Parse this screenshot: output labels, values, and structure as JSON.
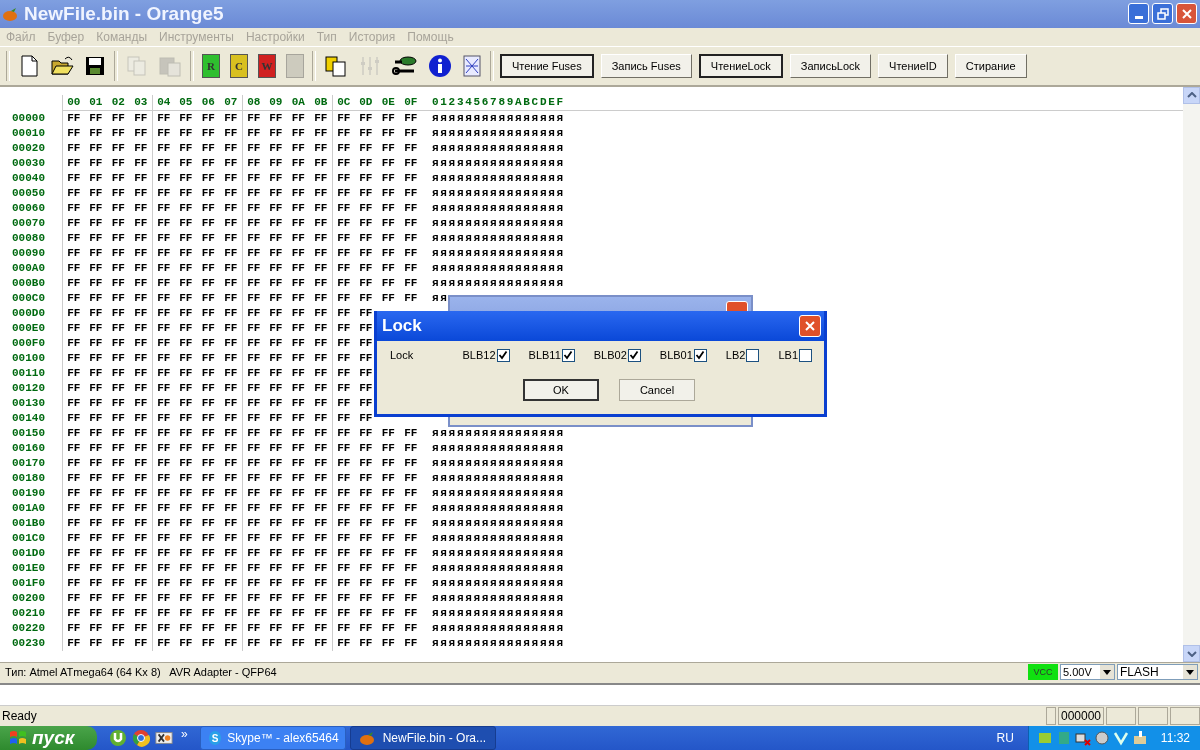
{
  "window": {
    "title": "NewFile.bin - Orange5"
  },
  "menu": [
    {
      "label": "Файл",
      "disabled": true
    },
    {
      "label": "Буфер",
      "disabled": true
    },
    {
      "label": "Команды",
      "disabled": true
    },
    {
      "label": "Инструменты",
      "disabled": true
    },
    {
      "label": "Настройки",
      "disabled": true
    },
    {
      "label": "Тип",
      "disabled": true
    },
    {
      "label": "История",
      "disabled": true
    },
    {
      "label": "Помощь",
      "disabled": true
    }
  ],
  "toolbar": {
    "groups": [
      [
        {
          "kind": "new",
          "disabled": false
        },
        {
          "kind": "open",
          "disabled": false
        },
        {
          "kind": "save",
          "disabled": false
        }
      ],
      [
        {
          "kind": "copy",
          "disabled": true
        },
        {
          "kind": "paste",
          "disabled": true
        }
      ],
      [
        {
          "kind": "chip",
          "label": "R",
          "color": "#2fbf2f",
          "disabled": false
        },
        {
          "kind": "chip",
          "label": "C",
          "color": "#d8c020",
          "disabled": false
        },
        {
          "kind": "chip",
          "label": "W",
          "color": "#d02020",
          "disabled": false
        },
        {
          "kind": "chip",
          "color": "#a8a8a0",
          "disabled": true
        }
      ],
      [
        {
          "kind": "clipboard",
          "disabled": false
        },
        {
          "kind": "sliders",
          "disabled": true
        },
        {
          "kind": "tools",
          "disabled": false
        },
        {
          "kind": "info",
          "disabled": false
        },
        {
          "kind": "pattern",
          "disabled": false
        }
      ]
    ],
    "buttons": [
      {
        "label": "Чтение Fuses",
        "selected": true
      },
      {
        "label": "Запись Fuses",
        "selected": false
      },
      {
        "label": "ЧтениеLock",
        "selected": true
      },
      {
        "label": "ЗаписьLock",
        "selected": false
      },
      {
        "label": "ЧтениеID",
        "selected": false
      },
      {
        "label": "Стирание",
        "selected": false
      }
    ]
  },
  "hex_view": {
    "columns": [
      "00",
      "01",
      "02",
      "03",
      "04",
      "05",
      "06",
      "07",
      "08",
      "09",
      "0A",
      "0B",
      "0C",
      "0D",
      "0E",
      "0F"
    ],
    "ascii_header": "0123456789ABCDEF",
    "rows": [
      {
        "address": "00000",
        "bytes": [
          "FF",
          "FF",
          "FF",
          "FF",
          "FF",
          "FF",
          "FF",
          "FF",
          "FF",
          "FF",
          "FF",
          "FF",
          "FF",
          "FF",
          "FF",
          "FF"
        ],
        "ascii": "яяяяяяяяяяяяяяяя"
      },
      {
        "address": "00010",
        "bytes": [
          "FF",
          "FF",
          "FF",
          "FF",
          "FF",
          "FF",
          "FF",
          "FF",
          "FF",
          "FF",
          "FF",
          "FF",
          "FF",
          "FF",
          "FF",
          "FF"
        ],
        "ascii": "яяяяяяяяяяяяяяяя"
      },
      {
        "address": "00020",
        "bytes": [
          "FF",
          "FF",
          "FF",
          "FF",
          "FF",
          "FF",
          "FF",
          "FF",
          "FF",
          "FF",
          "FF",
          "FF",
          "FF",
          "FF",
          "FF",
          "FF"
        ],
        "ascii": "яяяяяяяяяяяяяяяя"
      },
      {
        "address": "00030",
        "bytes": [
          "FF",
          "FF",
          "FF",
          "FF",
          "FF",
          "FF",
          "FF",
          "FF",
          "FF",
          "FF",
          "FF",
          "FF",
          "FF",
          "FF",
          "FF",
          "FF"
        ],
        "ascii": "яяяяяяяяяяяяяяяя"
      },
      {
        "address": "00040",
        "bytes": [
          "FF",
          "FF",
          "FF",
          "FF",
          "FF",
          "FF",
          "FF",
          "FF",
          "FF",
          "FF",
          "FF",
          "FF",
          "FF",
          "FF",
          "FF",
          "FF"
        ],
        "ascii": "яяяяяяяяяяяяяяяя"
      },
      {
        "address": "00050",
        "bytes": [
          "FF",
          "FF",
          "FF",
          "FF",
          "FF",
          "FF",
          "FF",
          "FF",
          "FF",
          "FF",
          "FF",
          "FF",
          "FF",
          "FF",
          "FF",
          "FF"
        ],
        "ascii": "яяяяяяяяяяяяяяяя"
      },
      {
        "address": "00060",
        "bytes": [
          "FF",
          "FF",
          "FF",
          "FF",
          "FF",
          "FF",
          "FF",
          "FF",
          "FF",
          "FF",
          "FF",
          "FF",
          "FF",
          "FF",
          "FF",
          "FF"
        ],
        "ascii": "яяяяяяяяяяяяяяяя"
      },
      {
        "address": "00070",
        "bytes": [
          "FF",
          "FF",
          "FF",
          "FF",
          "FF",
          "FF",
          "FF",
          "FF",
          "FF",
          "FF",
          "FF",
          "FF",
          "FF",
          "FF",
          "FF",
          "FF"
        ],
        "ascii": "яяяяяяяяяяяяяяяя"
      },
      {
        "address": "00080",
        "bytes": [
          "FF",
          "FF",
          "FF",
          "FF",
          "FF",
          "FF",
          "FF",
          "FF",
          "FF",
          "FF",
          "FF",
          "FF",
          "FF",
          "FF",
          "FF",
          "FF"
        ],
        "ascii": "яяяяяяяяяяяяяяяя"
      },
      {
        "address": "00090",
        "bytes": [
          "FF",
          "FF",
          "FF",
          "FF",
          "FF",
          "FF",
          "FF",
          "FF",
          "FF",
          "FF",
          "FF",
          "FF",
          "FF",
          "FF",
          "FF",
          "FF"
        ],
        "ascii": "яяяяяяяяяяяяяяяя"
      },
      {
        "address": "000A0",
        "bytes": [
          "FF",
          "FF",
          "FF",
          "FF",
          "FF",
          "FF",
          "FF",
          "FF",
          "FF",
          "FF",
          "FF",
          "FF",
          "FF",
          "FF",
          "FF",
          "FF"
        ],
        "ascii": "яяяяяяяяяяяяяяяя"
      },
      {
        "address": "000B0",
        "bytes": [
          "FF",
          "FF",
          "FF",
          "FF",
          "FF",
          "FF",
          "FF",
          "FF",
          "FF",
          "FF",
          "FF",
          "FF",
          "FF",
          "FF",
          "FF",
          "FF"
        ],
        "ascii": "яяяяяяяяяяяяяяяя"
      },
      {
        "address": "000C0",
        "bytes": [
          "FF",
          "FF",
          "FF",
          "FF",
          "FF",
          "FF",
          "FF",
          "FF",
          "FF",
          "FF",
          "FF",
          "FF",
          "FF",
          "FF",
          "FF",
          "FF"
        ],
        "ascii": "яя"
      },
      {
        "address": "000D0",
        "bytes": [
          "FF",
          "FF",
          "FF",
          "FF",
          "FF",
          "FF",
          "FF",
          "FF",
          "FF",
          "FF",
          "FF",
          "FF",
          "FF",
          "FF"
        ]
      },
      {
        "address": "000E0",
        "bytes": [
          "FF",
          "FF",
          "FF",
          "FF",
          "FF",
          "FF",
          "FF",
          "FF",
          "FF",
          "FF",
          "FF",
          "FF",
          "FF",
          "FF"
        ]
      },
      {
        "address": "000F0",
        "bytes": [
          "FF",
          "FF",
          "FF",
          "FF",
          "FF",
          "FF",
          "FF",
          "FF",
          "FF",
          "FF",
          "FF",
          "FF",
          "FF",
          "FF"
        ]
      },
      {
        "address": "00100",
        "bytes": [
          "FF",
          "FF",
          "FF",
          "FF",
          "FF",
          "FF",
          "FF",
          "FF",
          "FF",
          "FF",
          "FF",
          "FF",
          "FF",
          "FF"
        ]
      },
      {
        "address": "00110",
        "bytes": [
          "FF",
          "FF",
          "FF",
          "FF",
          "FF",
          "FF",
          "FF",
          "FF",
          "FF",
          "FF",
          "FF",
          "FF",
          "FF",
          "FF"
        ]
      },
      {
        "address": "00120",
        "bytes": [
          "FF",
          "FF",
          "FF",
          "FF",
          "FF",
          "FF",
          "FF",
          "FF",
          "FF",
          "FF",
          "FF",
          "FF",
          "FF",
          "FF"
        ]
      },
      {
        "address": "00130",
        "bytes": [
          "FF",
          "FF",
          "FF",
          "FF",
          "FF",
          "FF",
          "FF",
          "FF",
          "FF",
          "FF",
          "FF",
          "FF",
          "FF",
          "FF"
        ]
      },
      {
        "address": "00140",
        "bytes": [
          "FF",
          "FF",
          "FF",
          "FF",
          "FF",
          "FF",
          "FF",
          "FF",
          "FF",
          "FF",
          "FF",
          "FF",
          "FF",
          "FF"
        ]
      },
      {
        "address": "00150",
        "bytes": [
          "FF",
          "FF",
          "FF",
          "FF",
          "FF",
          "FF",
          "FF",
          "FF",
          "FF",
          "FF",
          "FF",
          "FF",
          "FF",
          "FF",
          "FF",
          "FF"
        ],
        "ascii": "яяяяяяяяяяяяяяяя"
      },
      {
        "address": "00160",
        "bytes": [
          "FF",
          "FF",
          "FF",
          "FF",
          "FF",
          "FF",
          "FF",
          "FF",
          "FF",
          "FF",
          "FF",
          "FF",
          "FF",
          "FF",
          "FF",
          "FF"
        ],
        "ascii": "яяяяяяяяяяяяяяяя"
      },
      {
        "address": "00170",
        "bytes": [
          "FF",
          "FF",
          "FF",
          "FF",
          "FF",
          "FF",
          "FF",
          "FF",
          "FF",
          "FF",
          "FF",
          "FF",
          "FF",
          "FF",
          "FF",
          "FF"
        ],
        "ascii": "яяяяяяяяяяяяяяяя"
      },
      {
        "address": "00180",
        "bytes": [
          "FF",
          "FF",
          "FF",
          "FF",
          "FF",
          "FF",
          "FF",
          "FF",
          "FF",
          "FF",
          "FF",
          "FF",
          "FF",
          "FF",
          "FF",
          "FF"
        ],
        "ascii": "яяяяяяяяяяяяяяяя"
      },
      {
        "address": "00190",
        "bytes": [
          "FF",
          "FF",
          "FF",
          "FF",
          "FF",
          "FF",
          "FF",
          "FF",
          "FF",
          "FF",
          "FF",
          "FF",
          "FF",
          "FF",
          "FF",
          "FF"
        ],
        "ascii": "яяяяяяяяяяяяяяяя"
      },
      {
        "address": "001A0",
        "bytes": [
          "FF",
          "FF",
          "FF",
          "FF",
          "FF",
          "FF",
          "FF",
          "FF",
          "FF",
          "FF",
          "FF",
          "FF",
          "FF",
          "FF",
          "FF",
          "FF"
        ],
        "ascii": "яяяяяяяяяяяяяяяя"
      },
      {
        "address": "001B0",
        "bytes": [
          "FF",
          "FF",
          "FF",
          "FF",
          "FF",
          "FF",
          "FF",
          "FF",
          "FF",
          "FF",
          "FF",
          "FF",
          "FF",
          "FF",
          "FF",
          "FF"
        ],
        "ascii": "яяяяяяяяяяяяяяяя"
      },
      {
        "address": "001C0",
        "bytes": [
          "FF",
          "FF",
          "FF",
          "FF",
          "FF",
          "FF",
          "FF",
          "FF",
          "FF",
          "FF",
          "FF",
          "FF",
          "FF",
          "FF",
          "FF",
          "FF"
        ],
        "ascii": "яяяяяяяяяяяяяяяя"
      },
      {
        "address": "001D0",
        "bytes": [
          "FF",
          "FF",
          "FF",
          "FF",
          "FF",
          "FF",
          "FF",
          "FF",
          "FF",
          "FF",
          "FF",
          "FF",
          "FF",
          "FF",
          "FF",
          "FF"
        ],
        "ascii": "яяяяяяяяяяяяяяяя"
      },
      {
        "address": "001E0",
        "bytes": [
          "FF",
          "FF",
          "FF",
          "FF",
          "FF",
          "FF",
          "FF",
          "FF",
          "FF",
          "FF",
          "FF",
          "FF",
          "FF",
          "FF",
          "FF",
          "FF"
        ],
        "ascii": "яяяяяяяяяяяяяяяя"
      },
      {
        "address": "001F0",
        "bytes": [
          "FF",
          "FF",
          "FF",
          "FF",
          "FF",
          "FF",
          "FF",
          "FF",
          "FF",
          "FF",
          "FF",
          "FF",
          "FF",
          "FF",
          "FF",
          "FF"
        ],
        "ascii": "яяяяяяяяяяяяяяяя"
      },
      {
        "address": "00200",
        "bytes": [
          "FF",
          "FF",
          "FF",
          "FF",
          "FF",
          "FF",
          "FF",
          "FF",
          "FF",
          "FF",
          "FF",
          "FF",
          "FF",
          "FF",
          "FF",
          "FF"
        ],
        "ascii": "яяяяяяяяяяяяяяяя"
      },
      {
        "address": "00210",
        "bytes": [
          "FF",
          "FF",
          "FF",
          "FF",
          "FF",
          "FF",
          "FF",
          "FF",
          "FF",
          "FF",
          "FF",
          "FF",
          "FF",
          "FF",
          "FF",
          "FF"
        ],
        "ascii": "яяяяяяяяяяяяяяяя"
      },
      {
        "address": "00220",
        "bytes": [
          "FF",
          "FF",
          "FF",
          "FF",
          "FF",
          "FF",
          "FF",
          "FF",
          "FF",
          "FF",
          "FF",
          "FF",
          "FF",
          "FF",
          "FF",
          "FF"
        ],
        "ascii": "яяяяяяяяяяяяяяяя"
      },
      {
        "address": "00230",
        "bytes": [
          "FF",
          "FF",
          "FF",
          "FF",
          "FF",
          "FF",
          "FF",
          "FF",
          "FF",
          "FF",
          "FF",
          "FF",
          "FF",
          "FF",
          "FF",
          "FF"
        ],
        "ascii": "яяяяяяяяяяяяяяяя"
      }
    ]
  },
  "lock_dialog": {
    "title": "Lock",
    "label": "Lock",
    "bits": [
      {
        "label": "BLB12",
        "checked": true
      },
      {
        "label": "BLB11",
        "checked": true
      },
      {
        "label": "BLB02",
        "checked": true
      },
      {
        "label": "BLB01",
        "checked": true
      },
      {
        "label": "LB2",
        "checked": false
      },
      {
        "label": "LB1",
        "checked": false
      }
    ],
    "buttons": [
      {
        "label": "OK",
        "default": true
      },
      {
        "label": "Cancel",
        "default": false
      }
    ]
  },
  "device_bar": {
    "info": "Тип: Atmel ATmega64 (64 Kx 8)   AVR Adapter - QFP64",
    "vcc": "VCC",
    "voltage": "5.00V",
    "memory": "FLASH"
  },
  "status_bar": {
    "text": "Ready",
    "address": "000000"
  },
  "taskbar": {
    "start": "пуск",
    "quick_launch": [
      {
        "kind": "torrent"
      },
      {
        "kind": "browser"
      },
      {
        "kind": "media"
      }
    ],
    "overflow": "»",
    "tasks": [
      {
        "label": "Skype™ - alex65464",
        "icon_letter": "S",
        "kind": "skype",
        "selected": false
      },
      {
        "label": "NewFile.bin - Ora...",
        "kind": "app",
        "selected": true
      }
    ],
    "language": "RU",
    "clock": "11:32"
  }
}
